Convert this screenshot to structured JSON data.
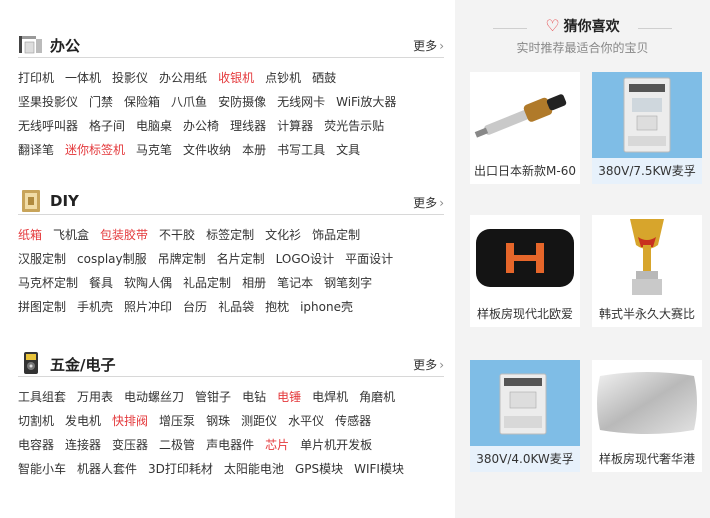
{
  "sections": [
    {
      "icon": "office-printer-icon",
      "title": "办公",
      "more": "更多",
      "rows": [
        [
          {
            "t": "打印机",
            "hot": false
          },
          {
            "t": "一体机",
            "hot": false
          },
          {
            "t": "投影仪",
            "hot": false
          },
          {
            "t": "办公用纸",
            "hot": false
          },
          {
            "t": "收银机",
            "hot": true
          },
          {
            "t": "点钞机",
            "hot": false
          },
          {
            "t": "硒鼓",
            "hot": false
          }
        ],
        [
          {
            "t": "坚果投影仪",
            "hot": false
          },
          {
            "t": "门禁",
            "hot": false
          },
          {
            "t": "保险箱",
            "hot": false
          },
          {
            "t": "八爪鱼",
            "hot": false
          },
          {
            "t": "安防摄像",
            "hot": false
          },
          {
            "t": "无线网卡",
            "hot": false
          },
          {
            "t": "WiFi放大器",
            "hot": false
          }
        ],
        [
          {
            "t": "无线呼叫器",
            "hot": false
          },
          {
            "t": "格子间",
            "hot": false
          },
          {
            "t": "电脑桌",
            "hot": false
          },
          {
            "t": "办公椅",
            "hot": false
          },
          {
            "t": "理线器",
            "hot": false
          },
          {
            "t": "计算器",
            "hot": false
          },
          {
            "t": "荧光告示贴",
            "hot": false
          }
        ],
        [
          {
            "t": "翻译笔",
            "hot": false
          },
          {
            "t": "迷你标签机",
            "hot": true
          },
          {
            "t": "马克笔",
            "hot": false
          },
          {
            "t": "文件收纳",
            "hot": false
          },
          {
            "t": "本册",
            "hot": false
          },
          {
            "t": "书写工具",
            "hot": false
          },
          {
            "t": "文具",
            "hot": false
          }
        ]
      ]
    },
    {
      "icon": "diy-box-icon",
      "title": "DIY",
      "more": "更多",
      "rows": [
        [
          {
            "t": "纸箱",
            "hot": true
          },
          {
            "t": "飞机盒",
            "hot": false
          },
          {
            "t": "包装胶带",
            "hot": true
          },
          {
            "t": "不干胶",
            "hot": false
          },
          {
            "t": "标签定制",
            "hot": false
          },
          {
            "t": "文化衫",
            "hot": false
          },
          {
            "t": "饰品定制",
            "hot": false
          }
        ],
        [
          {
            "t": "汉服定制",
            "hot": false
          },
          {
            "t": "cosplay制服",
            "hot": false
          },
          {
            "t": "吊牌定制",
            "hot": false
          },
          {
            "t": "名片定制",
            "hot": false
          },
          {
            "t": "LOGO设计",
            "hot": false
          },
          {
            "t": "平面设计",
            "hot": false
          }
        ],
        [
          {
            "t": "马克杯定制",
            "hot": false
          },
          {
            "t": "餐具",
            "hot": false
          },
          {
            "t": "软陶人偶",
            "hot": false
          },
          {
            "t": "礼品定制",
            "hot": false
          },
          {
            "t": "相册",
            "hot": false
          },
          {
            "t": "笔记本",
            "hot": false
          },
          {
            "t": "钢笔刻字",
            "hot": false
          }
        ],
        [
          {
            "t": "拼图定制",
            "hot": false
          },
          {
            "t": "手机壳",
            "hot": false
          },
          {
            "t": "照片冲印",
            "hot": false
          },
          {
            "t": "台历",
            "hot": false
          },
          {
            "t": "礼品袋",
            "hot": false
          },
          {
            "t": "抱枕",
            "hot": false
          },
          {
            "t": "iphone壳",
            "hot": false
          }
        ]
      ]
    },
    {
      "icon": "multimeter-icon",
      "title": "五金/电子",
      "more": "更多",
      "rows": [
        [
          {
            "t": "工具组套",
            "hot": false
          },
          {
            "t": "万用表",
            "hot": false
          },
          {
            "t": "电动螺丝刀",
            "hot": false
          },
          {
            "t": "管钳子",
            "hot": false
          },
          {
            "t": "电钻",
            "hot": false
          },
          {
            "t": "电锤",
            "hot": true
          },
          {
            "t": "电焊机",
            "hot": false
          },
          {
            "t": "角磨机",
            "hot": false
          }
        ],
        [
          {
            "t": "切割机",
            "hot": false
          },
          {
            "t": "发电机",
            "hot": false
          },
          {
            "t": "快排阀",
            "hot": true
          },
          {
            "t": "增压泵",
            "hot": false
          },
          {
            "t": "钢珠",
            "hot": false
          },
          {
            "t": "测距仪",
            "hot": false
          },
          {
            "t": "水平仪",
            "hot": false
          },
          {
            "t": "传感器",
            "hot": false
          }
        ],
        [
          {
            "t": "电容器",
            "hot": false
          },
          {
            "t": "连接器",
            "hot": false
          },
          {
            "t": "变压器",
            "hot": false
          },
          {
            "t": "二极管",
            "hot": false
          },
          {
            "t": "声电器件",
            "hot": false
          },
          {
            "t": "芯片",
            "hot": true
          },
          {
            "t": "单片机开发板",
            "hot": false
          }
        ],
        [
          {
            "t": "智能小车",
            "hot": false
          },
          {
            "t": "机器人套件",
            "hot": false
          },
          {
            "t": "3D打印耗材",
            "hot": false
          },
          {
            "t": "太阳能电池",
            "hot": false
          },
          {
            "t": "GPS模块",
            "hot": false
          },
          {
            "t": "WIFI模块",
            "hot": false
          }
        ]
      ]
    }
  ],
  "guess": {
    "icon": "heart-icon",
    "title": "猜你喜欢",
    "subtitle": "实时推荐最适合你的宝贝",
    "items": [
      {
        "caption": "出口日本新款M-60",
        "image": "gas-torch-image",
        "highlight": false
      },
      {
        "caption": "380V/7.5KW麦孚",
        "image": "inverter-image",
        "highlight": true
      },
      {
        "caption": "样板房现代北欧爱",
        "image": "black-h-pillow-image",
        "highlight": false
      },
      {
        "caption": "韩式半永久大赛比",
        "image": "trophy-image",
        "highlight": false
      },
      {
        "caption": "380V/4.0KW麦孚",
        "image": "inverter-image",
        "highlight": true
      },
      {
        "caption": "样板房现代奢华港",
        "image": "silver-pillow-image",
        "highlight": false
      }
    ]
  },
  "colors": {
    "hot": "#e4393c",
    "right_bg": "#f3f3f3",
    "highlight": "#e7f1fb",
    "inverter_bg": "#7fbde6"
  }
}
